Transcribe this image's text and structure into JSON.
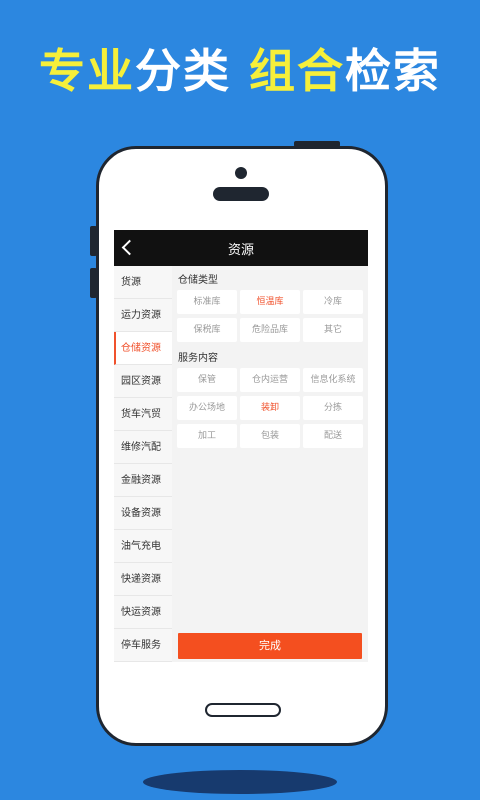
{
  "promo": {
    "part1": "专业",
    "part2": "分类",
    "part3": "组合",
    "part4": "检索"
  },
  "app": {
    "title": "资源",
    "back_icon": "chevron-left-icon"
  },
  "sidebar": {
    "items": [
      {
        "label": "货源",
        "active": false
      },
      {
        "label": "运力资源",
        "active": false
      },
      {
        "label": "仓储资源",
        "active": true
      },
      {
        "label": "园区资源",
        "active": false
      },
      {
        "label": "货车汽贸",
        "active": false
      },
      {
        "label": "维修汽配",
        "active": false
      },
      {
        "label": "金融资源",
        "active": false
      },
      {
        "label": "设备资源",
        "active": false
      },
      {
        "label": "油气充电",
        "active": false
      },
      {
        "label": "快递资源",
        "active": false
      },
      {
        "label": "快运资源",
        "active": false
      },
      {
        "label": "停车服务",
        "active": false
      }
    ]
  },
  "storage_type": {
    "title": "仓储类型",
    "options": [
      {
        "label": "标准库",
        "selected": false
      },
      {
        "label": "恒温库",
        "selected": true
      },
      {
        "label": "冷库",
        "selected": false
      },
      {
        "label": "保税库",
        "selected": false
      },
      {
        "label": "危险品库",
        "selected": false
      },
      {
        "label": "其它",
        "selected": false
      }
    ]
  },
  "service": {
    "title": "服务内容",
    "options": [
      {
        "label": "保管",
        "selected": false
      },
      {
        "label": "仓内运营",
        "selected": false
      },
      {
        "label": "信息化系统",
        "selected": false
      },
      {
        "label": "办公场地",
        "selected": false
      },
      {
        "label": "装卸",
        "selected": true
      },
      {
        "label": "分拣",
        "selected": false
      },
      {
        "label": "加工",
        "selected": false
      },
      {
        "label": "包装",
        "selected": false
      },
      {
        "label": "配送",
        "selected": false
      }
    ]
  },
  "done_label": "完成",
  "colors": {
    "background": "#2c87e0",
    "headline_yellow": "#f6ef3a",
    "accent": "#f0522d",
    "done_button": "#f44f1f"
  }
}
